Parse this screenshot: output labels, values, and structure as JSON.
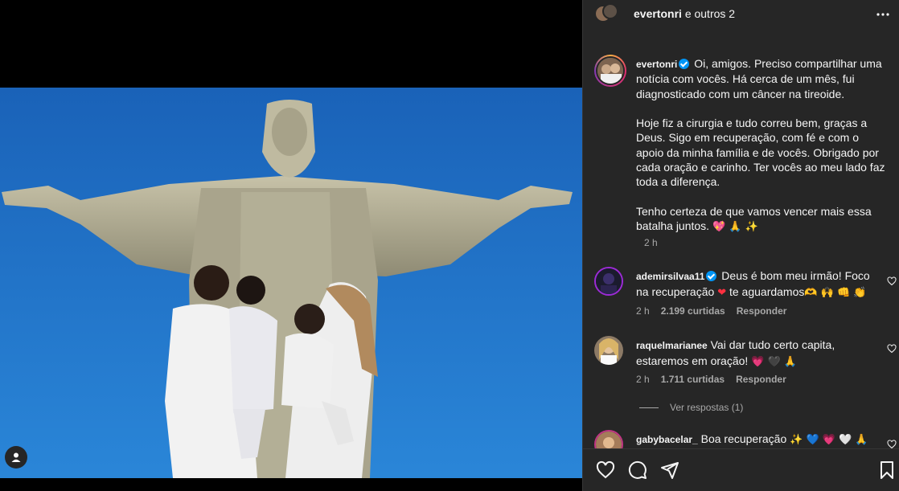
{
  "header": {
    "username": "evertonri",
    "others": "e outros 2"
  },
  "caption": {
    "username": "evertonri",
    "text": "Oi, amigos. Preciso compartilhar uma notícia com vocês. Há cerca de um mês, fui diagnosticado com um câncer na tireoide.\n\nHoje fiz a cirurgia e tudo correu bem, graças a Deus. Sigo em recuperação, com fé e com o apoio da minha família e de vocês. Obrigado por cada oração e carinho. Ter vocês ao meu lado faz toda a diferença.\n\nTenho certeza de que vamos vencer mais essa batalha juntos.",
    "emojis": "💖 🙏 ✨",
    "time": "2 h"
  },
  "comments": [
    {
      "username": "ademirsilvaa11",
      "text": "Deus é bom meu irmão! Foco na recuperação",
      "emoji1": "❤",
      "text2": "te aguardamos",
      "emoji2": "🫶 🙌 👊 👏",
      "time": "2 h",
      "likes": "2.199 curtidas",
      "reply": "Responder"
    },
    {
      "username": "raquelmarianee",
      "text": "Vai dar tudo certo capita, estaremos em oração!",
      "emoji": "💗 🖤 🙏",
      "time": "2 h",
      "likes": "1.711 curtidas",
      "reply": "Responder"
    },
    {
      "username": "gabybacelar_",
      "text": "Boa recuperação",
      "emoji": "✨ 💙 💗 🤍 🙏"
    }
  ],
  "view_replies": "Ver respostas (1)",
  "icons": {
    "like": "heart-icon",
    "comment": "comment-icon",
    "share": "share-icon",
    "save": "bookmark-icon",
    "more": "more-options-icon",
    "tag": "user-tag-icon"
  },
  "colors": {
    "panel_bg": "#262626",
    "verified": "#0095f6",
    "sky": "#1a6fc4"
  }
}
